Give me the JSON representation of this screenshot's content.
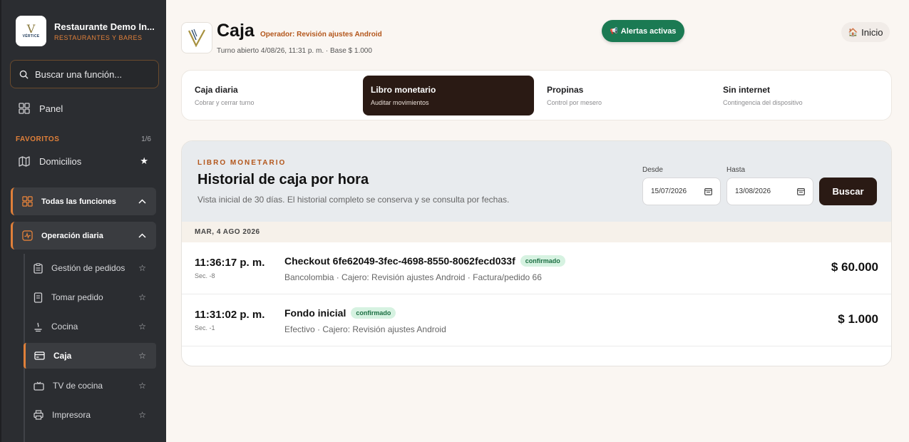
{
  "brand": {
    "name": "Restaurante Demo In...",
    "subtitle": "RESTAURANTES Y BARES",
    "logo_text": "VÉRTICE"
  },
  "sidebar": {
    "search_placeholder": "Buscar una función...",
    "panel_label": "Panel",
    "favorites_title": "FAVORITOS",
    "favorites_count": "1/6",
    "favorites": [
      {
        "label": "Domicilios",
        "icon": "map-icon",
        "starred": true
      }
    ],
    "groups": [
      {
        "label": "Todas las funciones",
        "icon": "grid-icon",
        "expanded": true
      },
      {
        "label": "Operación diaria",
        "icon": "activity-icon",
        "expanded": true
      }
    ],
    "items": [
      {
        "label": "Gestión de pedidos",
        "icon": "clipboard-icon"
      },
      {
        "label": "Tomar pedido",
        "icon": "notepad-icon"
      },
      {
        "label": "Cocina",
        "icon": "cooking-icon"
      },
      {
        "label": "Caja",
        "icon": "card-icon",
        "active": true
      },
      {
        "label": "TV de cocina",
        "icon": "tv-icon"
      },
      {
        "label": "Impresora",
        "icon": "printer-icon"
      }
    ]
  },
  "header": {
    "title": "Caja",
    "operator": "Operador: Revisión ajustes Android",
    "turno": "Turno abierto 4/08/26, 11:31 p. m. · Base $ 1.000",
    "alerts_label": "Alertas activas",
    "home_label": "Inicio"
  },
  "tabs": [
    {
      "label": "Caja diaria",
      "sub": "Cobrar y cerrar turno",
      "active": false
    },
    {
      "label": "Libro monetario",
      "sub": "Auditar movimientos",
      "active": true
    },
    {
      "label": "Propinas",
      "sub": "Control por mesero",
      "active": false
    },
    {
      "label": "Sin internet",
      "sub": "Contingencia del dispositivo",
      "active": false
    }
  ],
  "ledger": {
    "eyebrow": "LIBRO MONETARIO",
    "title": "Historial de caja por hora",
    "subtitle": "Vista inicial de 30 días. El historial completo se conserva y se consulta por fechas.",
    "from_label": "Desde",
    "from_value": "15/07/2026",
    "to_label": "Hasta",
    "to_value": "13/08/2026",
    "search_label": "Buscar",
    "day": "MAR, 4 AGO 2026",
    "entries": [
      {
        "time": "11:36:17 p. m.",
        "seq": "Sec. -8",
        "title": "Checkout 6fe62049-3fec-4698-8550-8062fecd033f",
        "status": "confirmado",
        "detail": "Bancolombia · Cajero: Revisión ajustes Android · Factura/pedido 66",
        "amount": "$ 60.000"
      },
      {
        "time": "11:31:02 p. m.",
        "seq": "Sec. -1",
        "title": "Fondo inicial",
        "status": "confirmado",
        "detail": "Efectivo · Cajero: Revisión ajustes Android",
        "amount": "$ 1.000"
      }
    ]
  },
  "colors": {
    "accent": "#e0803a",
    "sidebar_bg": "#2b2d31",
    "primary_dark": "#2a1a14",
    "success": "#1b7a53",
    "badge_bg": "#d6f2e1"
  }
}
